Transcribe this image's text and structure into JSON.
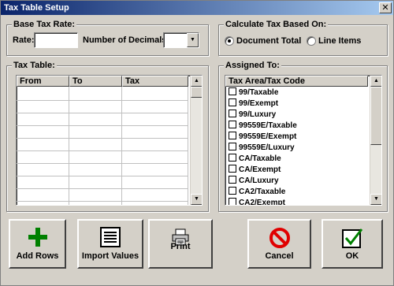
{
  "window": {
    "title": "Tax Table Setup",
    "close_glyph": "✕"
  },
  "base_rate": {
    "group_label": "Base Tax Rate:",
    "rate_label": "Rate:",
    "rate_value": "",
    "decimals_label": "Number of Decimals:",
    "decimals_value": ""
  },
  "calc": {
    "group_label": "Calculate Tax Based On:",
    "options": [
      {
        "label": "Document Total",
        "selected": true
      },
      {
        "label": "Line Items",
        "selected": false
      }
    ]
  },
  "tax_table": {
    "group_label": "Tax Table:",
    "columns": [
      "From",
      "To",
      "Tax"
    ]
  },
  "assigned": {
    "group_label": "Assigned To:",
    "column": "Tax Area/Tax Code",
    "items": [
      "99/Taxable",
      "99/Exempt",
      "99/Luxury",
      "99559E/Taxable",
      "99559E/Exempt",
      "99559E/Luxury",
      "CA/Taxable",
      "CA/Exempt",
      "CA/Luxury",
      "CA2/Taxable",
      "CA2/Exempt"
    ]
  },
  "buttons": {
    "add_rows": "Add Rows",
    "import_values": "Import Values",
    "print": "Print",
    "cancel": "Cancel",
    "ok": "OK"
  },
  "colors": {
    "add_icon": "#008000",
    "cancel_icon": "#e00000",
    "ok_check": "#008000"
  }
}
